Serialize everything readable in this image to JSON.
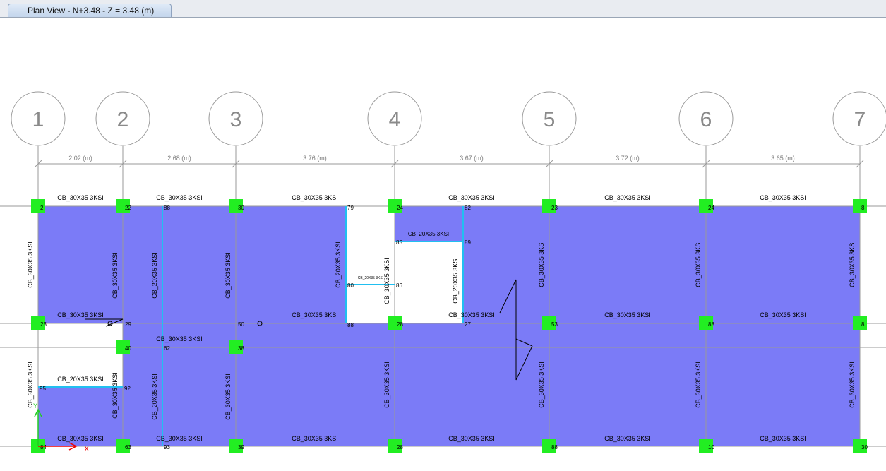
{
  "tab": {
    "title": "Plan View - N+3.48 - Z = 3.48 (m)"
  },
  "grid": {
    "labels": [
      "1",
      "2",
      "3",
      "4",
      "5",
      "6",
      "7"
    ],
    "spacings": [
      "2.02 (m)",
      "2.68 (m)",
      "3.76 (m)",
      "3.67 (m)",
      "3.72 (m)",
      "3.65 (m)"
    ]
  },
  "beams": {
    "row_top": [
      "CB_30X35 3KSI",
      "CB_30X35 3KSI",
      "CB_30X35 3KSI",
      "CB_30X35 3KSI",
      "CB_30X35 3KSI",
      "CB_30X35 3KSI"
    ],
    "row_mid": [
      "CB_30X35 3KSI",
      "CB_30X35 3KSI",
      "CB_30X35 3KSI",
      "CB_30X35 3KSI",
      "CB_30X35 3KSI"
    ],
    "row_mid2": [
      "CB_30X35 3KSI"
    ],
    "row_bottom": [
      "CB_30X35 3KSI",
      "CB_30X35 3KSI",
      "CB_30X35 3KSI",
      "CB_30X35 3KSI",
      "CB_30X35 3KSI",
      "CB_30X35 3KSI"
    ],
    "notch_beam": "CB_20X35 3KSI",
    "opening_beam": "CB_20X35 3KSI",
    "opening_small_beam": "CB_20X35 3KSI",
    "vert_upper": [
      "CB_30X35 3KSI",
      "CB_30X35 3KSI",
      "CB_20X35 3KSI",
      "CB_30X35 3KSI",
      "CB_20X35 3KSI",
      "CB_30X35 3KSI",
      "CB_20X35 3KSI",
      "CB_30X35 3KSI",
      "CB_30X35 3KSI",
      "CB_30X35 3KSI"
    ],
    "vert_lower": [
      "CB_30X35 3KSI",
      "CB_30X35 3KSI",
      "CB_20X35 3KSI",
      "CB_30X35 3KSI",
      "CB_30X35 3KSI",
      "CB_30X35 3KSI",
      "CB_30X35 3KSI",
      "CB_30X35 3KSI"
    ]
  },
  "joint_labels": {
    "top": [
      "2",
      "22",
      "88",
      "30",
      "79",
      "24",
      "82",
      "23",
      "24",
      "8"
    ],
    "opening": [
      "85",
      "89",
      "80",
      "86",
      "88"
    ],
    "mid": [
      "23",
      "29",
      "50",
      "86",
      "28",
      "27",
      "53",
      "88",
      "8"
    ],
    "mid2": [
      "40",
      "62",
      "38"
    ],
    "notch": [
      "95",
      "92"
    ],
    "bottom": [
      "84",
      "63",
      "93",
      "39",
      "28",
      "88",
      "10",
      "30"
    ]
  },
  "axes": {
    "x": "X",
    "y": "Y"
  },
  "colors": {
    "slab": "#7b7bf7",
    "column": "#22ee22",
    "beam_highlight": "#21bff0",
    "grid_line": "#9a9a9a",
    "grid_bubble": "#9a9a9a",
    "axis_x": "#ee0000",
    "axis_y": "#22cc22"
  }
}
